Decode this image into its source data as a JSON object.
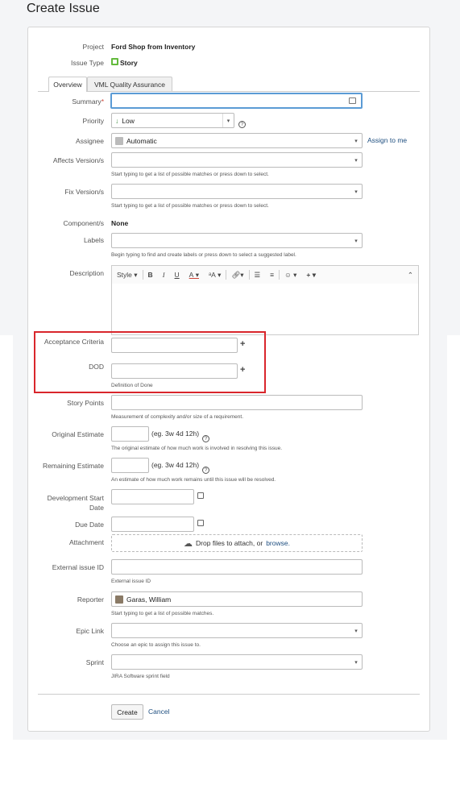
{
  "page_title": "Create Issue",
  "project": {
    "label": "Project",
    "value": "Ford Shop from Inventory"
  },
  "issue_type": {
    "label": "Issue Type",
    "value": "Story"
  },
  "tabs": [
    {
      "label": "Overview"
    },
    {
      "label": "VML Quality Assurance"
    }
  ],
  "fields": {
    "summary": {
      "label": "Summary"
    },
    "priority": {
      "label": "Priority",
      "value": "Low"
    },
    "assignee": {
      "label": "Assignee",
      "value": "Automatic",
      "assign_link": "Assign to me"
    },
    "affects_version": {
      "label": "Affects Version/s",
      "help": "Start typing to get a list of possible matches or press down to select."
    },
    "fix_version": {
      "label": "Fix Version/s",
      "help": "Start typing to get a list of possible matches or press down to select."
    },
    "component": {
      "label": "Component/s",
      "value": "None"
    },
    "labels": {
      "label": "Labels",
      "help": "Begin typing to find and create labels or press down to select a suggested label."
    },
    "description": {
      "label": "Description",
      "toolbar_style": "Style"
    },
    "acceptance_criteria": {
      "label": "Acceptance Criteria"
    },
    "dod": {
      "label": "DOD",
      "help": "Definition of Done"
    },
    "story_points": {
      "label": "Story Points",
      "help": "Measurement of complexity and/or size of a requirement."
    },
    "original_estimate": {
      "label": "Original Estimate",
      "hint": "(eg. 3w 4d 12h)",
      "help": "The original estimate of how much work is involved in resolving this issue."
    },
    "remaining_estimate": {
      "label": "Remaining Estimate",
      "hint": "(eg. 3w 4d 12h)",
      "help": "An estimate of how much work remains until this issue will be resolved."
    },
    "dev_start_date": {
      "label_line1": "Development Start",
      "label_line2": "Date"
    },
    "due_date": {
      "label": "Due Date"
    },
    "attachment": {
      "label": "Attachment",
      "drop_text": "Drop files to attach, or",
      "browse": "browse."
    },
    "external_id": {
      "label": "External issue ID",
      "help": "External issue ID"
    },
    "reporter": {
      "label": "Reporter",
      "value": "Garas, William",
      "help": "Start typing to get a list of possible matches."
    },
    "epic_link": {
      "label": "Epic Link",
      "help": "Choose an epic to assign this issue to."
    },
    "sprint": {
      "label": "Sprint",
      "help": "JIRA Software sprint field"
    }
  },
  "buttons": {
    "create": "Create",
    "cancel": "Cancel"
  },
  "colors": {
    "accent": "#205081",
    "highlight_box": "#d9262c",
    "story_icon": "#63ba3c"
  }
}
